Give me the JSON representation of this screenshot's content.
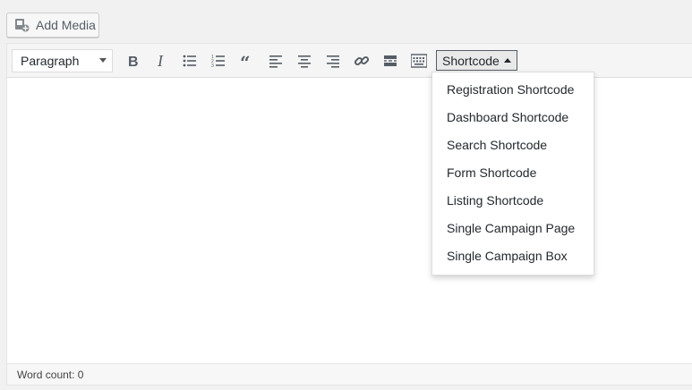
{
  "add_media": {
    "label": "Add Media",
    "icon": "media-icon"
  },
  "toolbar": {
    "format_select": {
      "value": "Paragraph"
    },
    "buttons": [
      {
        "name": "bold-icon"
      },
      {
        "name": "italic-icon"
      },
      {
        "name": "bullet-list-icon"
      },
      {
        "name": "numbered-list-icon"
      },
      {
        "name": "blockquote-icon"
      },
      {
        "name": "align-left-icon"
      },
      {
        "name": "align-center-icon"
      },
      {
        "name": "align-right-icon"
      },
      {
        "name": "link-icon"
      },
      {
        "name": "read-more-icon"
      },
      {
        "name": "toolbar-toggle-icon"
      }
    ],
    "shortcode_label": "Shortcode"
  },
  "shortcode_menu": {
    "items": [
      "Registration Shortcode",
      "Dashboard Shortcode",
      "Search Shortcode",
      "Form Shortcode",
      "Listing Shortcode",
      "Single Campaign Page",
      "Single Campaign Box"
    ]
  },
  "status": {
    "word_count": "Word count: 0"
  }
}
